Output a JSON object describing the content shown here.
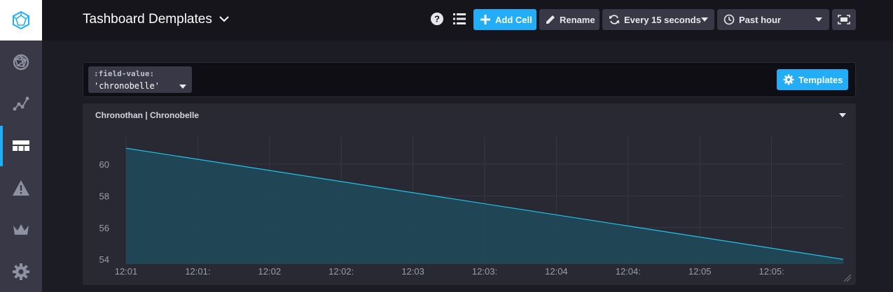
{
  "header": {
    "title": "Tashboard Demplates",
    "add_cell_label": "Add Cell",
    "rename_label": "Rename",
    "refresh_label": "Every 15 seconds",
    "time_range_label": "Past hour"
  },
  "sidebar": {
    "items": [
      {
        "icon": "logo-icon"
      },
      {
        "icon": "globe-network-icon"
      },
      {
        "icon": "graph-icon"
      },
      {
        "icon": "dashboards-icon",
        "active": true
      },
      {
        "icon": "alert-triangle-icon"
      },
      {
        "icon": "crown-icon"
      },
      {
        "icon": "gear-icon"
      }
    ]
  },
  "template_bar": {
    "variable_name": ":field-value:",
    "variable_value": "'chronobelle'",
    "templates_label": "Templates"
  },
  "cell": {
    "title": "Chronothan | Chronobelle"
  },
  "colors": {
    "accent": "#22adf6",
    "line": "#22c4f0",
    "fill": "#1f4a5c"
  },
  "chart_data": {
    "type": "area",
    "title": "Chronothan | Chronobelle",
    "x_tick_labels": [
      "12:01",
      "12:01:",
      "12:02",
      "12:02:",
      "12:03",
      "12:03:",
      "12:04",
      "12:04:",
      "12:05",
      "12:05:"
    ],
    "y_ticks": [
      54,
      56,
      58,
      60
    ],
    "ylim": [
      53.7,
      61.8
    ],
    "series": [
      {
        "x": [
          0,
          1
        ],
        "values": [
          61.0,
          54.0
        ]
      }
    ],
    "grid": true
  }
}
